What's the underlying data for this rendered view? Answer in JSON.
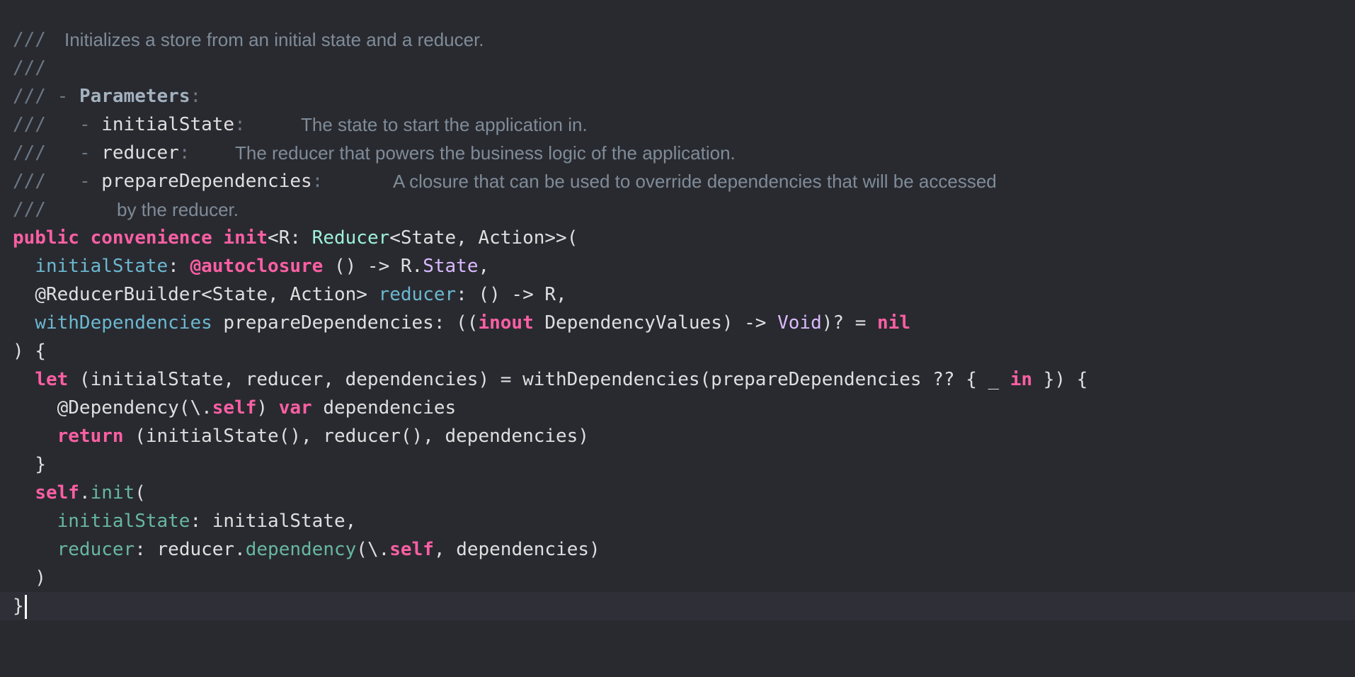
{
  "doc": {
    "slashes": "///",
    "summary": "Initializes a store from an initial state and a reducer.",
    "dash": "-",
    "parameters_label": "Parameters",
    "colon": ":",
    "params": [
      {
        "name": "initialState",
        "desc": "The state to start the application in."
      },
      {
        "name": "reducer",
        "desc": "The reducer that powers the business logic of the application."
      },
      {
        "name": "prepareDependencies",
        "desc": "A closure that can be used to override dependencies that will be accessed",
        "desc_cont": "by the reducer."
      }
    ]
  },
  "code": {
    "l1": {
      "public": "public",
      "convenience": "convenience",
      "init": "init",
      "lt": "<R: ",
      "reducer_type": "Reducer",
      "generic": "<State, Action>>("
    },
    "l2": {
      "label": "initialState",
      "colon": ": ",
      "autoclosure": "@autoclosure",
      "arrow": " () -> R.",
      "state": "State",
      "comma": ","
    },
    "l3": {
      "builder": "@ReducerBuilder<State, Action> ",
      "label": "reducer",
      "rest": ": () -> R,"
    },
    "l4": {
      "label": "withDependencies",
      "name": " prepareDependencies: ((",
      "inout": "inout",
      "deps": " DependencyValues) -> ",
      "void": "Void",
      "opt": ")? = ",
      "nil": "nil"
    },
    "l5": {
      "text": ") {"
    },
    "l6": {
      "let": "let",
      "body": " (initialState, reducer, dependencies) = withDependencies(prepareDependencies ?? { _ ",
      "in": "in",
      "end": " }) {"
    },
    "l7": {
      "attr": "@Dependency(\\.",
      "self": "self",
      "close": ") ",
      "var": "var",
      "name": " dependencies"
    },
    "l8": {
      "return": "return",
      "body": " (initialState(), reducer(), dependencies)"
    },
    "l9": {
      "text": "}"
    },
    "l10": {
      "self": "self",
      "dot": ".",
      "init": "init",
      "paren": "("
    },
    "l11": {
      "label": "initialState",
      "rest": ": initialState,"
    },
    "l12": {
      "label": "reducer",
      "mid": ": reducer.",
      "method": "dependency",
      "open": "(\\.",
      "self": "self",
      "rest": ", dependencies)"
    },
    "l13": {
      "text": ")"
    },
    "l14": {
      "text": "}"
    }
  }
}
